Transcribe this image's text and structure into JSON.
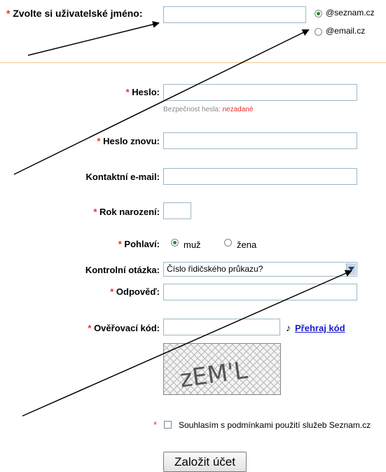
{
  "username": {
    "required_mark": "*",
    "label": "Zvolte si uživatelské jméno:",
    "value": "",
    "domains": [
      {
        "label": "@seznam.cz",
        "selected": true
      },
      {
        "label": "@email.cz",
        "selected": false
      }
    ]
  },
  "password": {
    "required_mark": "*",
    "label": "Heslo:",
    "value": "",
    "strength_label": "Bezpečnost hesla:",
    "strength_value": "nezadané",
    "strength_color": "#e8322d"
  },
  "password_again": {
    "required_mark": "*",
    "label": "Heslo znovu:",
    "value": ""
  },
  "contact_email": {
    "label": "Kontaktní e-mail:",
    "value": ""
  },
  "birth_year": {
    "required_mark": "*",
    "label": "Rok narození:",
    "value": ""
  },
  "gender": {
    "required_mark": "*",
    "label": "Pohlaví:",
    "options": [
      {
        "label": "muž",
        "selected": true
      },
      {
        "label": "žena",
        "selected": false
      }
    ]
  },
  "security_question": {
    "label": "Kontrolní otázka:",
    "selected": "Číslo řidičského průkazu?"
  },
  "answer": {
    "required_mark": "*",
    "label": "Odpověď:",
    "value": ""
  },
  "captcha": {
    "required_mark": "*",
    "label": "Ověřovací kód:",
    "value": "",
    "audio_icon": "music-note-icon",
    "audio_link": "Přehraj kód",
    "image_text": "zEM'L"
  },
  "terms": {
    "required_mark": "*",
    "checked": false,
    "label": "Souhlasím s podmínkami použití služeb Seznam.cz"
  },
  "submit": {
    "label": "Založit účet"
  },
  "colors": {
    "required": "#e8322d",
    "divider": "#f2c989",
    "input_border": "#9eb7c7",
    "link": "#1a1acb",
    "radio_dot": "#2e8b2e"
  }
}
